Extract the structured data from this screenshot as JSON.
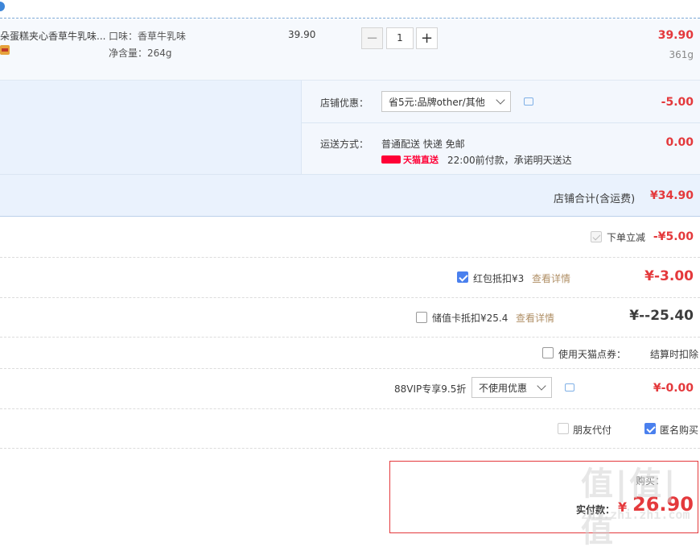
{
  "item": {
    "title": "朵蛋糕夹心香草牛乳味...",
    "flavor": "口味：香草牛乳味",
    "net_weight": "净含量：264g",
    "unit_price": "39.90",
    "quantity": "1",
    "subtotal": "39.90",
    "weight": "361g"
  },
  "shop_discount": {
    "label": "店铺优惠：",
    "selected": "省5元:品牌other/其他",
    "amount": "-5.00"
  },
  "shipping": {
    "label": "运送方式：",
    "method": "普通配送 快递 免邮",
    "badge": "天猫直送",
    "note": "22:00前付款，承诺明天送达",
    "amount": "0.00"
  },
  "shop_total": {
    "label": "店铺合计(含运费)",
    "amount": "¥34.90"
  },
  "order_discount": {
    "label": "下单立减",
    "amount": "-¥5.00"
  },
  "red_packet": {
    "label": "红包抵扣¥3",
    "link": "查看详情",
    "amount": "¥-3.00"
  },
  "stored_card": {
    "label": "储值卡抵扣¥25.4",
    "link": "查看详情",
    "amount": "¥--25.40"
  },
  "tmall_points": {
    "label": "使用天猫点券：",
    "note": "结算时扣除"
  },
  "vip": {
    "label": "88VIP专享9.5折",
    "selected": "不使用优惠",
    "amount": "¥-0.00"
  },
  "options": {
    "friend_pay": "朋友代付",
    "anonymous": "匿名购买"
  },
  "payment": {
    "label": "实付款：",
    "currency": "¥",
    "amount": "26.90",
    "partial_label": "购买："
  },
  "watermark": {
    "logo": "值|值|值",
    "site": "zhi.zhi.zhi.com"
  },
  "colors": {
    "accent_red": "#e4393c",
    "check_blue": "#4a80ee",
    "tmall_red": "#ff0036",
    "link_brown": "#b08f66"
  }
}
